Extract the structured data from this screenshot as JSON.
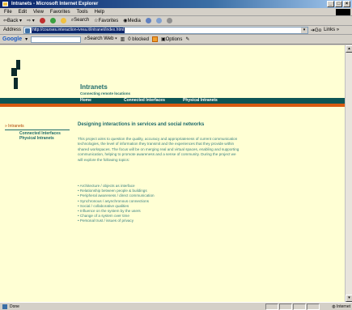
{
  "window": {
    "title": "Intranets - Microsoft Internet Explorer",
    "min": "_",
    "max": "□",
    "close": "×"
  },
  "menu": [
    "File",
    "Edit",
    "View",
    "Favorites",
    "Tools",
    "Help"
  ],
  "toolbar": {
    "back": "Back",
    "search": "Search",
    "favorites": "Favorites",
    "media": "Media"
  },
  "address": {
    "label": "Address",
    "url": "http://courses.interaction-ivrea.it/intranet/index.html",
    "go": "Go",
    "links": "Links »"
  },
  "google": {
    "logo": "Google",
    "search_web": "Search Web",
    "blocked": "0 blocked",
    "options": "Options"
  },
  "site": {
    "title": "Intranets",
    "tagline": "Connecting remote locations",
    "nav": [
      "Home",
      "Connected Interfaces",
      "Physical Intranets"
    ]
  },
  "sidebar": {
    "heading": "» Intranets",
    "items": [
      "Connected Interfaces",
      "Physical Intranets"
    ]
  },
  "content": {
    "title": "Designing interactions in services and social networks",
    "paragraph": "This project aims to question the quality, accuracy and appropriateness of current communication technologies, the level of information they transmit and the experiences that they provide within shared workspaces. The focus will be on merging real and virtual spaces, enabling and supporting communication, helping to promote awareness and a sense of community. During the project we will explore the following topics:",
    "topics": [
      "Architecture / objects as interface",
      "Relationship between people & buildings",
      "Peripheral awareness / direct communication",
      "Synchronous / asynchronous connections",
      "Social / collaborative qualities",
      "Influence on the system by the users",
      "Change of a system over time",
      "Personal trust / issues of privacy"
    ]
  },
  "status": {
    "left": "Done",
    "zone": "Internet"
  }
}
